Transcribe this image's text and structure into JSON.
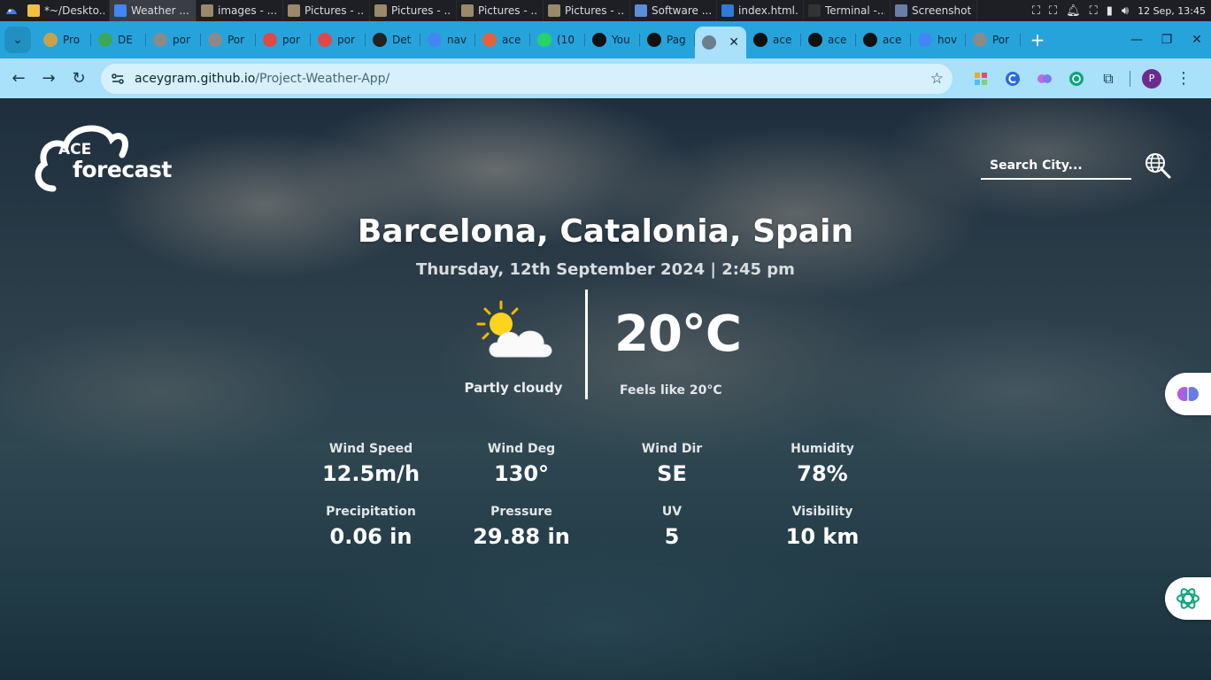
{
  "taskbar": {
    "apps": [
      {
        "label": "*~/Deskto...",
        "color": "#f0c040"
      },
      {
        "label": "Weather ...",
        "color": "#4285f4"
      },
      {
        "label": "images - ...",
        "color": "#9a8a6a"
      },
      {
        "label": "Pictures - ...",
        "color": "#9a8a6a"
      },
      {
        "label": "Pictures - ...",
        "color": "#9a8a6a"
      },
      {
        "label": "Pictures - ...",
        "color": "#9a8a6a"
      },
      {
        "label": "Pictures - ...",
        "color": "#9a8a6a"
      },
      {
        "label": "Software ...",
        "color": "#5a8fd8"
      },
      {
        "label": "index.html...",
        "color": "#2f7bd6"
      },
      {
        "label": "Terminal -...",
        "color": "#333333"
      },
      {
        "label": "Screenshot",
        "color": "#6a7fa8"
      }
    ],
    "clock": "12 Sep, 13:45"
  },
  "browser": {
    "tabs": [
      {
        "label": "Pro",
        "icon": "shield-icon",
        "color": "#c8a24a"
      },
      {
        "label": "DE",
        "icon": "badge-icon",
        "color": "#3aa85a"
      },
      {
        "label": "por",
        "icon": "globe-icon",
        "color": "#8a8a8a"
      },
      {
        "label": "Por",
        "icon": "globe-icon",
        "color": "#8a8a8a"
      },
      {
        "label": "por",
        "icon": "bolt-icon",
        "color": "#e04848"
      },
      {
        "label": "por",
        "icon": "bolt-icon",
        "color": "#e04848"
      },
      {
        "label": "Det",
        "icon": "openai-icon",
        "color": "#222222"
      },
      {
        "label": "nav",
        "icon": "google-icon",
        "color": "#4285f4"
      },
      {
        "label": "ace",
        "icon": "figma-icon",
        "color": "#e0623a"
      },
      {
        "label": "(10",
        "icon": "whatsapp-icon",
        "color": "#25d366"
      },
      {
        "label": "You",
        "icon": "github-icon",
        "color": "#111111"
      },
      {
        "label": "Pag",
        "icon": "github-icon",
        "color": "#111111"
      },
      {
        "label": "ace",
        "icon": "github-icon",
        "color": "#111111"
      },
      {
        "label": "ace",
        "icon": "github-icon",
        "color": "#111111"
      },
      {
        "label": "ace",
        "icon": "github-icon",
        "color": "#111111"
      },
      {
        "label": "hov",
        "icon": "google-icon",
        "color": "#4285f4"
      },
      {
        "label": "Por",
        "icon": "globe-icon",
        "color": "#8a8a8a"
      }
    ],
    "url_host": "aceygram.github.io",
    "url_path": "/Project-Weather-App/",
    "profile_initial": "P"
  },
  "app": {
    "logo_small": "ACE",
    "logo_big": "forecast",
    "search_placeholder": "Search City...",
    "location": "Barcelona, Catalonia, Spain",
    "datetime": "Thursday, 12th September 2024 | 2:45 pm",
    "condition": "Partly cloudy",
    "temperature": "20°C",
    "feels_like": "Feels like 20°C",
    "stats": [
      {
        "label": "Wind Speed",
        "value": "12.5m/h"
      },
      {
        "label": "Wind Deg",
        "value": "130°"
      },
      {
        "label": "Wind Dir",
        "value": "SE"
      },
      {
        "label": "Humidity",
        "value": "78%"
      },
      {
        "label": "Precipitation",
        "value": "0.06 in"
      },
      {
        "label": "Pressure",
        "value": "29.88 in"
      },
      {
        "label": "UV",
        "value": "5"
      },
      {
        "label": "Visibility",
        "value": "10 km"
      }
    ]
  }
}
